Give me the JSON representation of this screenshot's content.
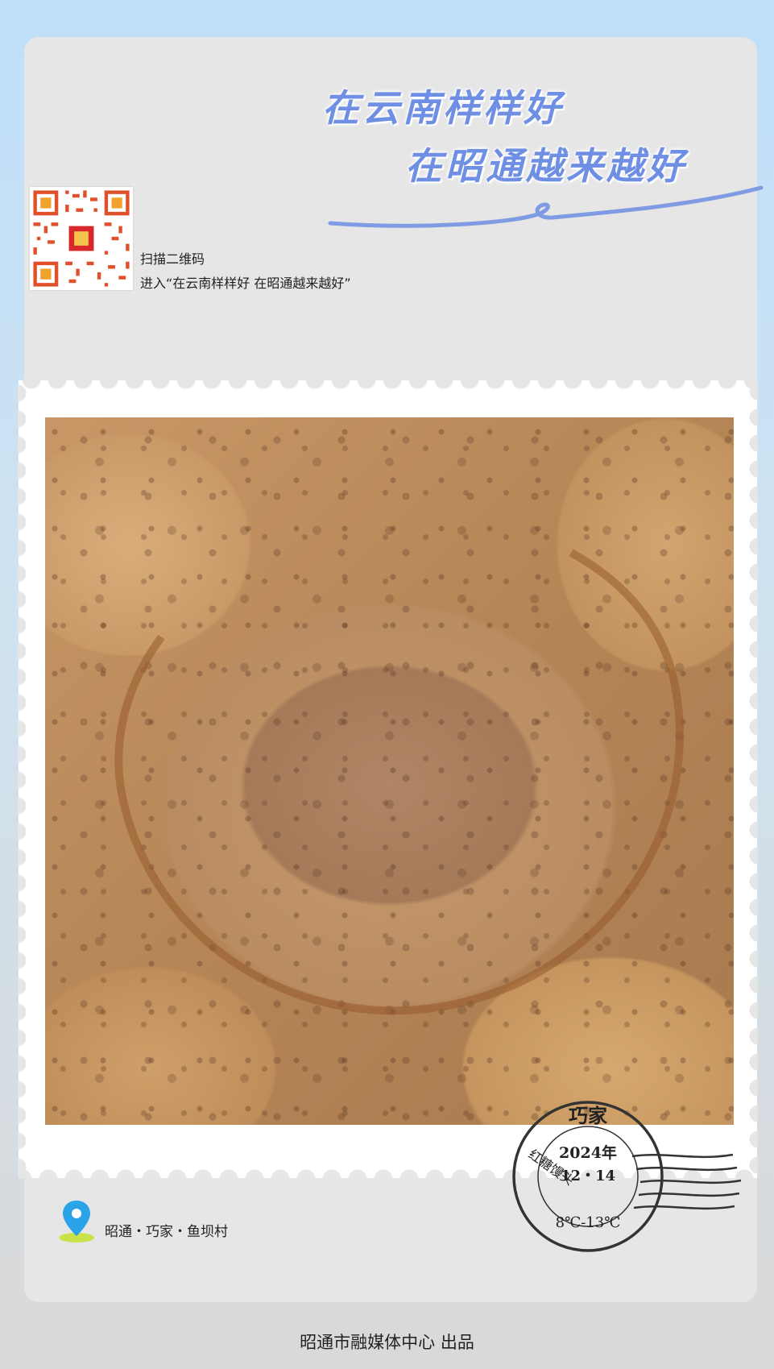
{
  "headline": {
    "line1": "在云南样样好",
    "line2": "在昭通越来越好"
  },
  "qr": {
    "caption1": "扫描二维码",
    "caption2": "进入“在云南样样好 在昭通越来越好”",
    "icon": "qr-code-icon"
  },
  "photo": {
    "icon": "brown-sugar-bun-photo"
  },
  "location": {
    "icon": "map-pin-icon",
    "text": "昭通・巧家・鱼坝村"
  },
  "postmark": {
    "place": "巧家",
    "year": "2024年",
    "date": "12・14",
    "item": "红糖馒头",
    "temp": "8℃-13℃"
  },
  "footer": {
    "credit": "昭通市融媒体中心  出品"
  },
  "colors": {
    "headline": "#6e8fe3",
    "card": "#e6e6e6",
    "pin": "#2aa3e8"
  }
}
